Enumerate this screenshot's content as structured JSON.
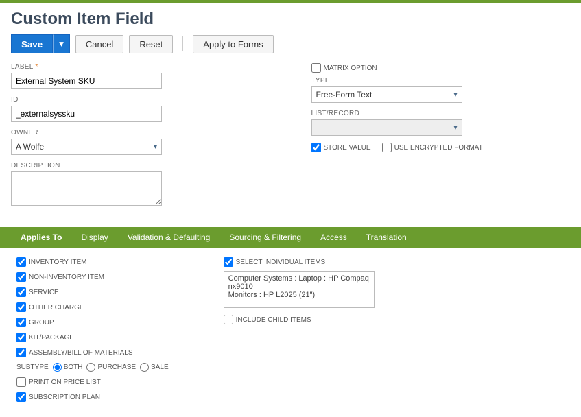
{
  "page_title": "Custom Item Field",
  "buttons": {
    "save": "Save",
    "cancel": "Cancel",
    "reset": "Reset",
    "apply": "Apply to Forms"
  },
  "labels": {
    "label": "LABEL",
    "id": "ID",
    "owner": "OWNER",
    "description": "DESCRIPTION",
    "matrix_option": "MATRIX OPTION",
    "type": "TYPE",
    "list_record": "LIST/RECORD",
    "store_value": "STORE VALUE",
    "use_encrypted": "USE ENCRYPTED FORMAT",
    "subtype": "SUBTYPE",
    "both": "BOTH",
    "purchase": "PURCHASE",
    "sale": "SALE",
    "select_individual": "SELECT INDIVIDUAL ITEMS",
    "include_child": "INCLUDE CHILD ITEMS"
  },
  "values": {
    "label": "External System SKU",
    "id": "_externalsyssku",
    "owner": "A Wolfe",
    "description": "",
    "type": "Free-Form Text",
    "list_record": "",
    "selected_items": "Computer Systems : Laptop : HP Compaq nx9010\nMonitors : HP L2025 (21\")"
  },
  "checkboxes": {
    "matrix_option": false,
    "store_value": true,
    "use_encrypted": false,
    "select_individual": true,
    "include_child": false,
    "print_on_price_list": false
  },
  "tabs": [
    "Applies To",
    "Display",
    "Validation & Defaulting",
    "Sourcing & Filtering",
    "Access",
    "Translation"
  ],
  "applies_to_items": [
    {
      "label": "INVENTORY ITEM",
      "checked": true
    },
    {
      "label": "NON-INVENTORY ITEM",
      "checked": true
    },
    {
      "label": "SERVICE",
      "checked": true
    },
    {
      "label": "OTHER CHARGE",
      "checked": true
    },
    {
      "label": "GROUP",
      "checked": true
    },
    {
      "label": "KIT/PACKAGE",
      "checked": true
    },
    {
      "label": "ASSEMBLY/BILL OF MATERIALS",
      "checked": true
    }
  ],
  "applies_to_tail": [
    {
      "label": "PRINT ON PRICE LIST",
      "checked": false
    },
    {
      "label": "SUBSCRIPTION PLAN",
      "checked": true
    }
  ]
}
